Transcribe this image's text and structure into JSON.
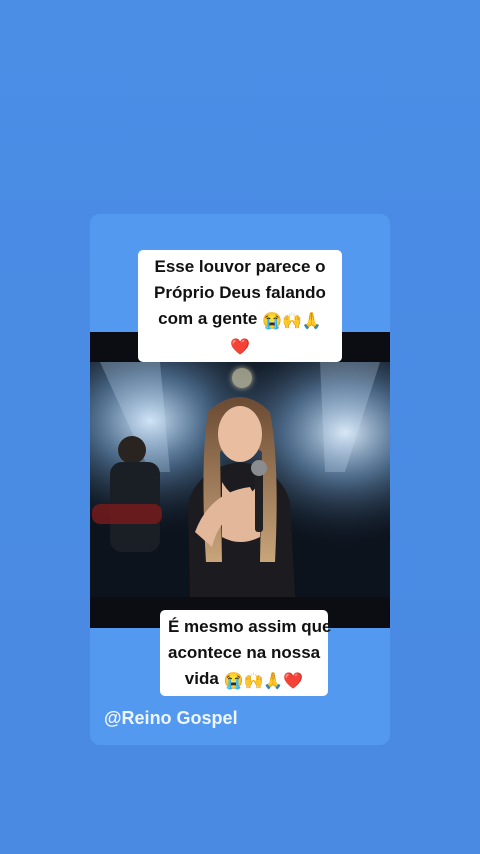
{
  "post": {
    "caption_top": {
      "line1": "Esse louvor parece o",
      "line2": "Próprio Deus falando",
      "line3_text": "com a gente",
      "line3_emojis": "😭🙌🙏",
      "line4_emojis": "❤️"
    },
    "caption_bottom": {
      "line1": "É mesmo assim que",
      "line2": "acontece na nossa",
      "line3_text": "vida",
      "line3_emojis": "😭🙌🙏❤️"
    },
    "handle": "@Reino Gospel"
  },
  "colors": {
    "background": "#4a8ce4",
    "card": "#5499f0",
    "caption_bg": "#ffffff",
    "caption_text": "#111111",
    "heart": "#e0141e"
  },
  "icons": {
    "video": "video-frame",
    "tap_indicator": "tap-dot"
  }
}
